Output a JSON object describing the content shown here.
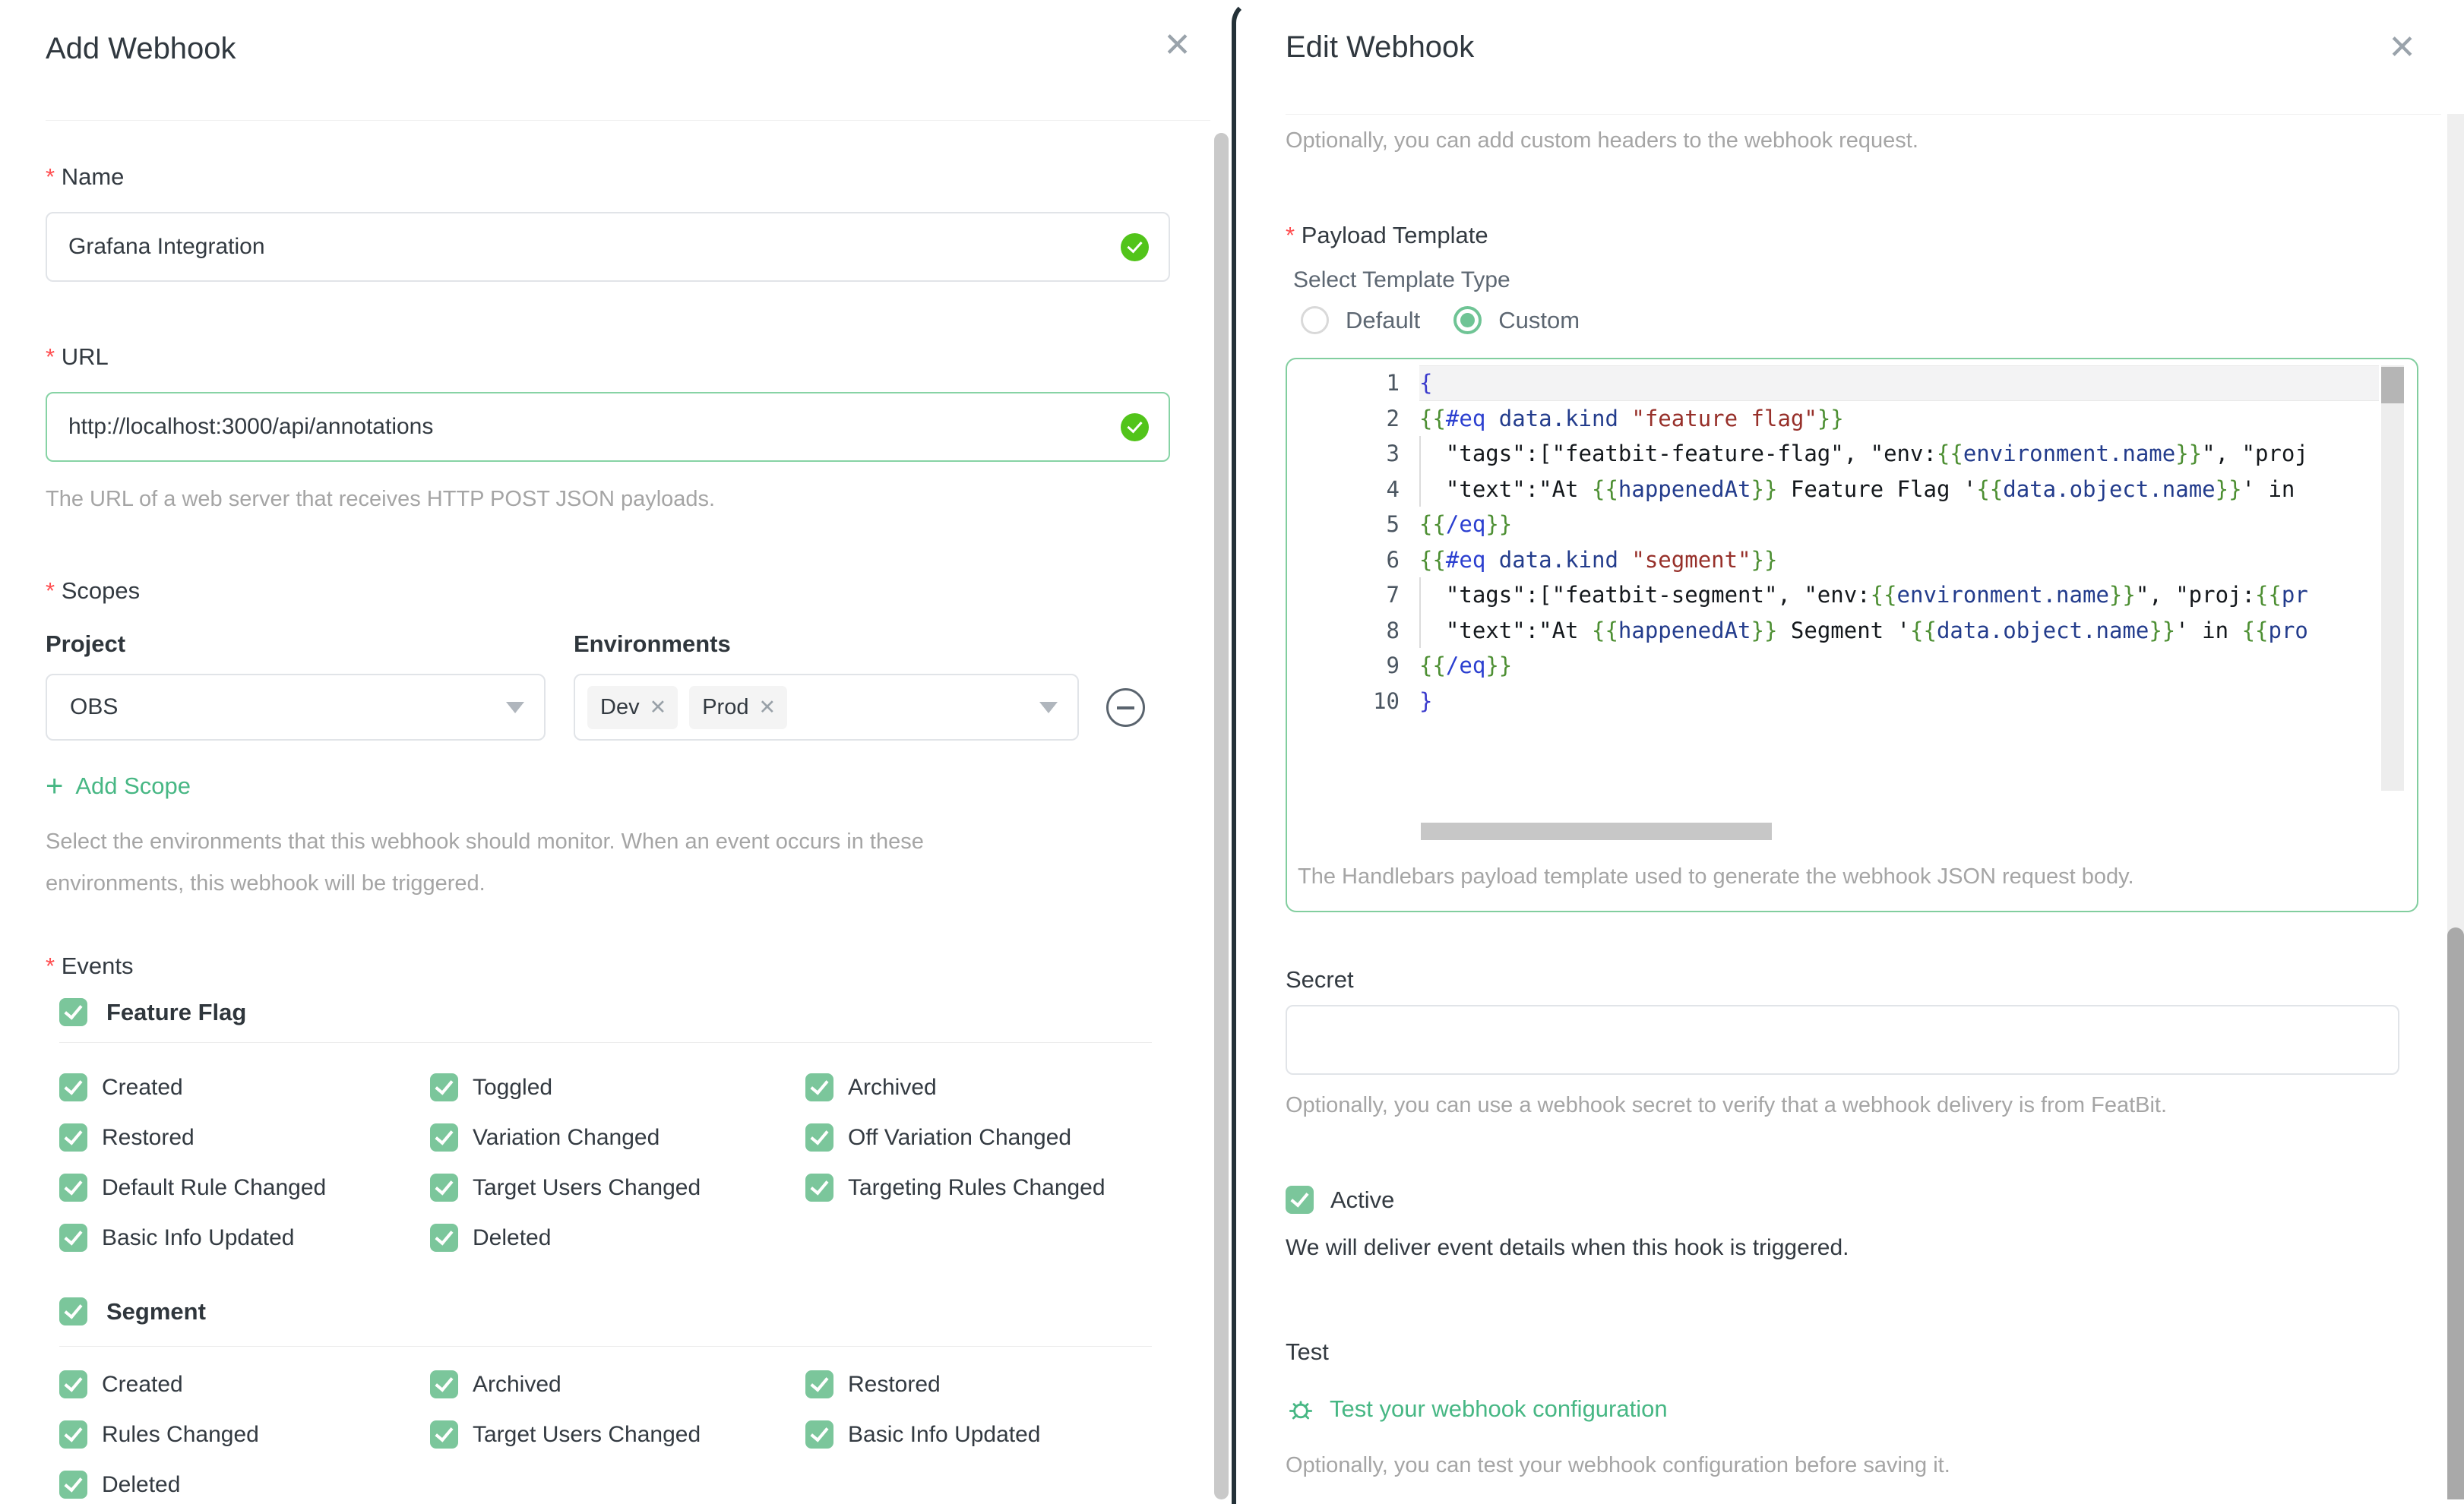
{
  "colors": {
    "accent_green": "#47b784",
    "checkbox_green": "#7bc69b",
    "valid_check_green": "#52c41a",
    "valid_input_border": "#87d3a5",
    "editor_border": "#82ce9f",
    "required_red": "#ff4d4f",
    "modal_edge_dark": "#243138"
  },
  "add_webhook": {
    "title": "Add Webhook",
    "fields": {
      "name": {
        "label": "Name",
        "required": true,
        "value": "Grafana Integration",
        "valid": true
      },
      "url": {
        "label": "URL",
        "required": true,
        "value": "http://localhost:3000/api/annotations",
        "valid": true,
        "help": "The URL of a web server that receives HTTP POST JSON payloads."
      }
    },
    "scopes": {
      "label": "Scopes",
      "required": true,
      "project_label": "Project",
      "project_value": "OBS",
      "environments_label": "Environments",
      "environment_tags": [
        "Dev",
        "Prod"
      ],
      "add_scope_label": "Add Scope",
      "help": "Select the environments that this webhook should monitor. When an event occurs in these environments, this webhook will be triggered."
    },
    "events": {
      "label": "Events",
      "required": true,
      "groups": [
        {
          "label": "Feature Flag",
          "checked": true,
          "items": [
            "Created",
            "Toggled",
            "Archived",
            "Restored",
            "Variation Changed",
            "Off Variation Changed",
            "Default Rule Changed",
            "Target Users Changed",
            "Targeting Rules Changed",
            "Basic Info Updated",
            "Deleted"
          ]
        },
        {
          "label": "Segment",
          "checked": true,
          "items": [
            "Created",
            "Archived",
            "Restored",
            "Rules Changed",
            "Target Users Changed",
            "Basic Info Updated",
            "Deleted"
          ]
        }
      ]
    }
  },
  "edit_webhook": {
    "title": "Edit Webhook",
    "headers_help": "Optionally, you can add custom headers to the webhook request.",
    "payload_template": {
      "label": "Payload Template",
      "required": true,
      "type_label": "Select Template Type",
      "type_options": [
        {
          "label": "Default",
          "selected": false
        },
        {
          "label": "Custom",
          "selected": true
        }
      ],
      "help": "The Handlebars payload template used to generate the webhook JSON request body.",
      "code_lines": [
        {
          "n": 1,
          "active": true,
          "tokens": [
            [
              "br",
              "{"
            ]
          ]
        },
        {
          "n": 2,
          "tokens": [
            [
              "hb",
              "{{"
            ],
            [
              "kw",
              "#eq"
            ],
            [
              "pl",
              " "
            ],
            [
              "pa",
              "data.kind"
            ],
            [
              "pl",
              " "
            ],
            [
              "st",
              "\"feature flag\""
            ],
            [
              "hb",
              "}}"
            ]
          ]
        },
        {
          "n": 3,
          "guide": true,
          "tokens": [
            [
              "pl",
              "  \"tags\":[\"featbit-feature-flag\", \"env:"
            ],
            [
              "hb",
              "{{"
            ],
            [
              "pa",
              "environment.name"
            ],
            [
              "hb",
              "}}"
            ],
            [
              "pl",
              "\", \"proj"
            ]
          ]
        },
        {
          "n": 4,
          "guide": true,
          "tokens": [
            [
              "pl",
              "  \"text\":\"At "
            ],
            [
              "hb",
              "{{"
            ],
            [
              "pa",
              "happenedAt"
            ],
            [
              "hb",
              "}}"
            ],
            [
              "pl",
              " Feature Flag '"
            ],
            [
              "hb",
              "{{"
            ],
            [
              "pa",
              "data.object.name"
            ],
            [
              "hb",
              "}}"
            ],
            [
              "pl",
              "' in"
            ]
          ]
        },
        {
          "n": 5,
          "tokens": [
            [
              "hb",
              "{{"
            ],
            [
              "kw",
              "/eq"
            ],
            [
              "hb",
              "}}"
            ]
          ]
        },
        {
          "n": 6,
          "tokens": [
            [
              "hb",
              "{{"
            ],
            [
              "kw",
              "#eq"
            ],
            [
              "pl",
              " "
            ],
            [
              "pa",
              "data.kind"
            ],
            [
              "pl",
              " "
            ],
            [
              "st",
              "\"segment\""
            ],
            [
              "hb",
              "}}"
            ]
          ]
        },
        {
          "n": 7,
          "guide": true,
          "tokens": [
            [
              "pl",
              "  \"tags\":[\"featbit-segment\", \"env:"
            ],
            [
              "hb",
              "{{"
            ],
            [
              "pa",
              "environment.name"
            ],
            [
              "hb",
              "}}"
            ],
            [
              "pl",
              "\", \"proj:"
            ],
            [
              "hb",
              "{{"
            ],
            [
              "pa",
              "pr"
            ]
          ]
        },
        {
          "n": 8,
          "guide": true,
          "tokens": [
            [
              "pl",
              "  \"text\":\"At "
            ],
            [
              "hb",
              "{{"
            ],
            [
              "pa",
              "happenedAt"
            ],
            [
              "hb",
              "}}"
            ],
            [
              "pl",
              " Segment '"
            ],
            [
              "hb",
              "{{"
            ],
            [
              "pa",
              "data.object.name"
            ],
            [
              "hb",
              "}}"
            ],
            [
              "pl",
              "' in "
            ],
            [
              "hb",
              "{{"
            ],
            [
              "pa",
              "pro"
            ]
          ]
        },
        {
          "n": 9,
          "tokens": [
            [
              "hb",
              "{{"
            ],
            [
              "kw",
              "/eq"
            ],
            [
              "hb",
              "}}"
            ]
          ]
        },
        {
          "n": 10,
          "tokens": [
            [
              "br",
              "}"
            ]
          ]
        }
      ]
    },
    "secret": {
      "label": "Secret",
      "value": "",
      "help": "Optionally, you can use a webhook secret to verify that a webhook delivery is from FeatBit."
    },
    "active": {
      "label": "Active",
      "checked": true,
      "help": "We will deliver event details when this hook is triggered."
    },
    "test": {
      "label": "Test",
      "link": "Test your webhook configuration",
      "help": "Optionally, you can test your webhook configuration before saving it."
    }
  }
}
